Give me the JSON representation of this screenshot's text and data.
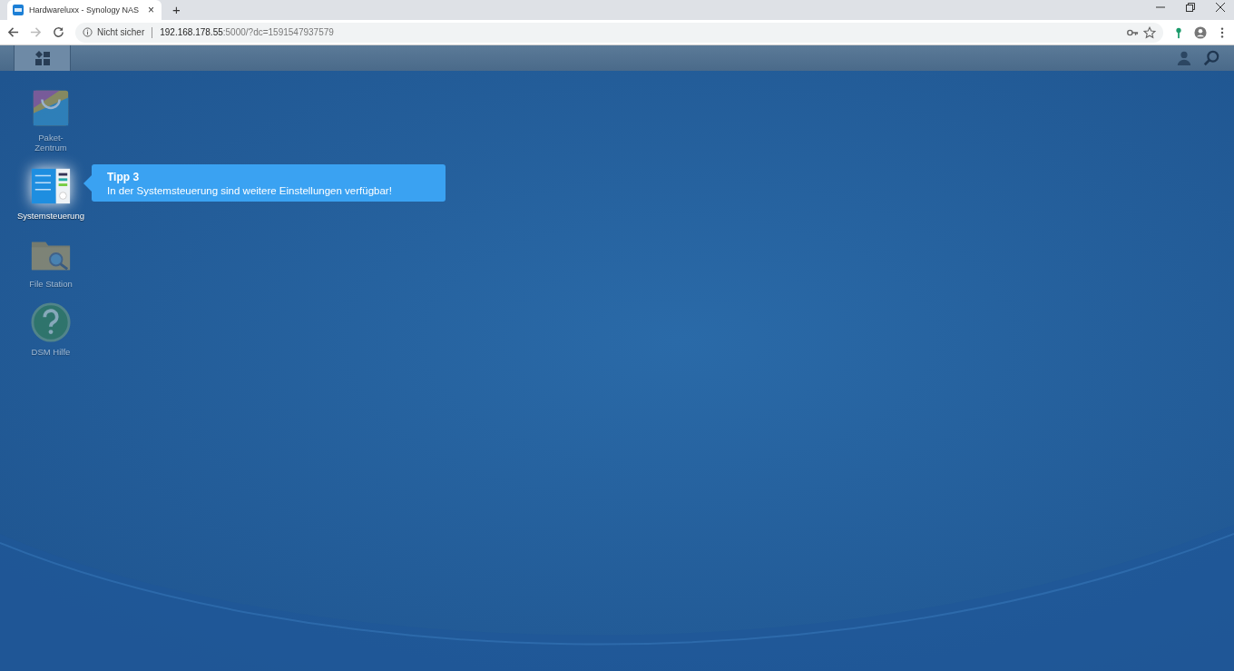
{
  "browser": {
    "tab": {
      "title": "Hardwareluxx - Synology NAS",
      "close": "×"
    },
    "new_tab": "+",
    "security": "Nicht sicher",
    "url_host": "192.168.178.55",
    "url_rest": ":5000/?dc=1591547937579"
  },
  "desktop_icons": [
    {
      "kind": "package",
      "label": "Paket-\nZentrum",
      "highlighted": false
    },
    {
      "kind": "control-panel",
      "label": "Systemsteuerung",
      "highlighted": true
    },
    {
      "kind": "folder",
      "label": "File Station",
      "highlighted": false
    },
    {
      "kind": "help",
      "label": "DSM Hilfe",
      "highlighted": false
    }
  ],
  "tooltip": {
    "title": "Tipp 3",
    "text": "In der Systemsteuerung sind weitere Einstellungen verfügbar!"
  }
}
